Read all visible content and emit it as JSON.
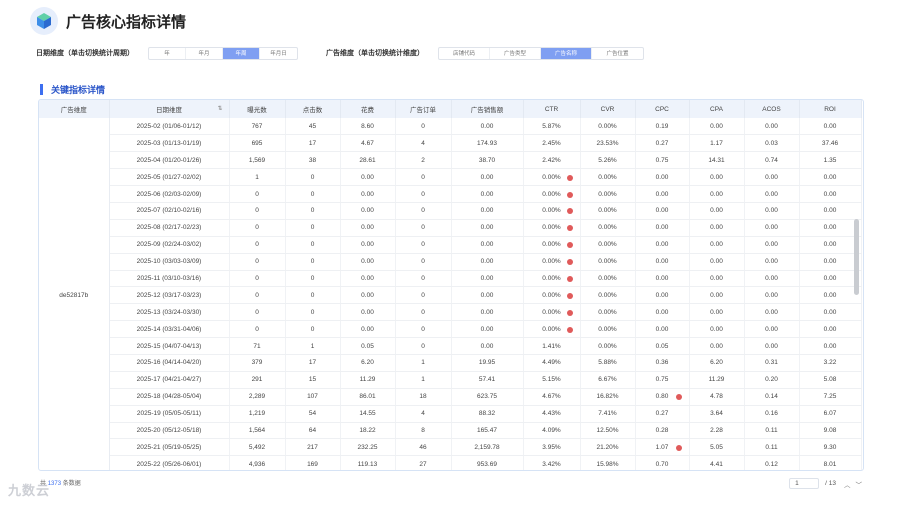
{
  "header": {
    "title": "广告核心指标详情"
  },
  "filters": {
    "date_label": "日期维度（单击切换统计周期）",
    "date_options": [
      "年",
      "年月",
      "年周",
      "年月日"
    ],
    "date_selected": 2,
    "ad_label": "广告维度（单击切换统计维度）",
    "ad_options": [
      "店铺代码",
      "广告类型",
      "广告名称",
      "广告位置"
    ],
    "ad_selected": 2
  },
  "section": {
    "title": "关键指标详情"
  },
  "table": {
    "columns": [
      "广告维度",
      "日期维度",
      "曝光数",
      "点击数",
      "花费",
      "广告订单",
      "广告销售额",
      "CTR",
      "CVR",
      "CPC",
      "CPA",
      "ACOS",
      "ROI"
    ],
    "group_label": "de52817b",
    "rows": [
      {
        "date": "2025-02 (01/06-01/12)",
        "imp": "767",
        "clk": "45",
        "cost": "8.60",
        "ord": "0",
        "sales": "0.00",
        "ctr": "5.87%",
        "cvr": "0.00%",
        "cpc": "0.19",
        "cpa": "0.00",
        "acos": "0.00",
        "roi": "0.00",
        "ctr_flag": false,
        "cpc_flag": false
      },
      {
        "date": "2025-03 (01/13-01/19)",
        "imp": "695",
        "clk": "17",
        "cost": "4.67",
        "ord": "4",
        "sales": "174.93",
        "ctr": "2.45%",
        "cvr": "23.53%",
        "cpc": "0.27",
        "cpa": "1.17",
        "acos": "0.03",
        "roi": "37.46",
        "ctr_flag": false,
        "cpc_flag": false
      },
      {
        "date": "2025-04 (01/20-01/26)",
        "imp": "1,569",
        "clk": "38",
        "cost": "28.61",
        "ord": "2",
        "sales": "38.70",
        "ctr": "2.42%",
        "cvr": "5.26%",
        "cpc": "0.75",
        "cpa": "14.31",
        "acos": "0.74",
        "roi": "1.35",
        "ctr_flag": false,
        "cpc_flag": false
      },
      {
        "date": "2025-05 (01/27-02/02)",
        "imp": "1",
        "clk": "0",
        "cost": "0.00",
        "ord": "0",
        "sales": "0.00",
        "ctr": "0.00%",
        "cvr": "0.00%",
        "cpc": "0.00",
        "cpa": "0.00",
        "acos": "0.00",
        "roi": "0.00",
        "ctr_flag": true,
        "cpc_flag": false
      },
      {
        "date": "2025-06 (02/03-02/09)",
        "imp": "0",
        "clk": "0",
        "cost": "0.00",
        "ord": "0",
        "sales": "0.00",
        "ctr": "0.00%",
        "cvr": "0.00%",
        "cpc": "0.00",
        "cpa": "0.00",
        "acos": "0.00",
        "roi": "0.00",
        "ctr_flag": true,
        "cpc_flag": false
      },
      {
        "date": "2025-07 (02/10-02/16)",
        "imp": "0",
        "clk": "0",
        "cost": "0.00",
        "ord": "0",
        "sales": "0.00",
        "ctr": "0.00%",
        "cvr": "0.00%",
        "cpc": "0.00",
        "cpa": "0.00",
        "acos": "0.00",
        "roi": "0.00",
        "ctr_flag": true,
        "cpc_flag": false
      },
      {
        "date": "2025-08 (02/17-02/23)",
        "imp": "0",
        "clk": "0",
        "cost": "0.00",
        "ord": "0",
        "sales": "0.00",
        "ctr": "0.00%",
        "cvr": "0.00%",
        "cpc": "0.00",
        "cpa": "0.00",
        "acos": "0.00",
        "roi": "0.00",
        "ctr_flag": true,
        "cpc_flag": false
      },
      {
        "date": "2025-09 (02/24-03/02)",
        "imp": "0",
        "clk": "0",
        "cost": "0.00",
        "ord": "0",
        "sales": "0.00",
        "ctr": "0.00%",
        "cvr": "0.00%",
        "cpc": "0.00",
        "cpa": "0.00",
        "acos": "0.00",
        "roi": "0.00",
        "ctr_flag": true,
        "cpc_flag": false
      },
      {
        "date": "2025-10 (03/03-03/09)",
        "imp": "0",
        "clk": "0",
        "cost": "0.00",
        "ord": "0",
        "sales": "0.00",
        "ctr": "0.00%",
        "cvr": "0.00%",
        "cpc": "0.00",
        "cpa": "0.00",
        "acos": "0.00",
        "roi": "0.00",
        "ctr_flag": true,
        "cpc_flag": false
      },
      {
        "date": "2025-11 (03/10-03/16)",
        "imp": "0",
        "clk": "0",
        "cost": "0.00",
        "ord": "0",
        "sales": "0.00",
        "ctr": "0.00%",
        "cvr": "0.00%",
        "cpc": "0.00",
        "cpa": "0.00",
        "acos": "0.00",
        "roi": "0.00",
        "ctr_flag": true,
        "cpc_flag": false
      },
      {
        "date": "2025-12 (03/17-03/23)",
        "imp": "0",
        "clk": "0",
        "cost": "0.00",
        "ord": "0",
        "sales": "0.00",
        "ctr": "0.00%",
        "cvr": "0.00%",
        "cpc": "0.00",
        "cpa": "0.00",
        "acos": "0.00",
        "roi": "0.00",
        "ctr_flag": true,
        "cpc_flag": false
      },
      {
        "date": "2025-13 (03/24-03/30)",
        "imp": "0",
        "clk": "0",
        "cost": "0.00",
        "ord": "0",
        "sales": "0.00",
        "ctr": "0.00%",
        "cvr": "0.00%",
        "cpc": "0.00",
        "cpa": "0.00",
        "acos": "0.00",
        "roi": "0.00",
        "ctr_flag": true,
        "cpc_flag": false
      },
      {
        "date": "2025-14 (03/31-04/06)",
        "imp": "0",
        "clk": "0",
        "cost": "0.00",
        "ord": "0",
        "sales": "0.00",
        "ctr": "0.00%",
        "cvr": "0.00%",
        "cpc": "0.00",
        "cpa": "0.00",
        "acos": "0.00",
        "roi": "0.00",
        "ctr_flag": true,
        "cpc_flag": false
      },
      {
        "date": "2025-15 (04/07-04/13)",
        "imp": "71",
        "clk": "1",
        "cost": "0.05",
        "ord": "0",
        "sales": "0.00",
        "ctr": "1.41%",
        "cvr": "0.00%",
        "cpc": "0.05",
        "cpa": "0.00",
        "acos": "0.00",
        "roi": "0.00",
        "ctr_flag": false,
        "cpc_flag": false
      },
      {
        "date": "2025-16 (04/14-04/20)",
        "imp": "379",
        "clk": "17",
        "cost": "6.20",
        "ord": "1",
        "sales": "19.95",
        "ctr": "4.49%",
        "cvr": "5.88%",
        "cpc": "0.36",
        "cpa": "6.20",
        "acos": "0.31",
        "roi": "3.22",
        "ctr_flag": false,
        "cpc_flag": false
      },
      {
        "date": "2025-17 (04/21-04/27)",
        "imp": "291",
        "clk": "15",
        "cost": "11.29",
        "ord": "1",
        "sales": "57.41",
        "ctr": "5.15%",
        "cvr": "6.67%",
        "cpc": "0.75",
        "cpa": "11.29",
        "acos": "0.20",
        "roi": "5.08",
        "ctr_flag": false,
        "cpc_flag": false
      },
      {
        "date": "2025-18 (04/28-05/04)",
        "imp": "2,289",
        "clk": "107",
        "cost": "86.01",
        "ord": "18",
        "sales": "623.75",
        "ctr": "4.67%",
        "cvr": "16.82%",
        "cpc": "0.80",
        "cpa": "4.78",
        "acos": "0.14",
        "roi": "7.25",
        "ctr_flag": false,
        "cpc_flag": true
      },
      {
        "date": "2025-19 (05/05-05/11)",
        "imp": "1,219",
        "clk": "54",
        "cost": "14.55",
        "ord": "4",
        "sales": "88.32",
        "ctr": "4.43%",
        "cvr": "7.41%",
        "cpc": "0.27",
        "cpa": "3.64",
        "acos": "0.16",
        "roi": "6.07",
        "ctr_flag": false,
        "cpc_flag": false
      },
      {
        "date": "2025-20 (05/12-05/18)",
        "imp": "1,564",
        "clk": "64",
        "cost": "18.22",
        "ord": "8",
        "sales": "165.47",
        "ctr": "4.09%",
        "cvr": "12.50%",
        "cpc": "0.28",
        "cpa": "2.28",
        "acos": "0.11",
        "roi": "9.08",
        "ctr_flag": false,
        "cpc_flag": false
      },
      {
        "date": "2025-21 (05/19-05/25)",
        "imp": "5,492",
        "clk": "217",
        "cost": "232.25",
        "ord": "46",
        "sales": "2,159.78",
        "ctr": "3.95%",
        "cvr": "21.20%",
        "cpc": "1.07",
        "cpa": "5.05",
        "acos": "0.11",
        "roi": "9.30",
        "ctr_flag": false,
        "cpc_flag": true
      },
      {
        "date": "2025-22 (05/26-06/01)",
        "imp": "4,936",
        "clk": "169",
        "cost": "119.13",
        "ord": "27",
        "sales": "953.69",
        "ctr": "3.42%",
        "cvr": "15.98%",
        "cpc": "0.70",
        "cpa": "4.41",
        "acos": "0.12",
        "roi": "8.01",
        "ctr_flag": false,
        "cpc_flag": false
      }
    ]
  },
  "footer": {
    "prefix": "共",
    "count": "1373",
    "suffix": "条数据"
  },
  "pager": {
    "page": "1",
    "total": "/ 13"
  },
  "colors": {
    "accent": "#3d6ff0",
    "selected": "#7f9ff2",
    "flag": "#e05a5a"
  },
  "watermark": "九数云"
}
